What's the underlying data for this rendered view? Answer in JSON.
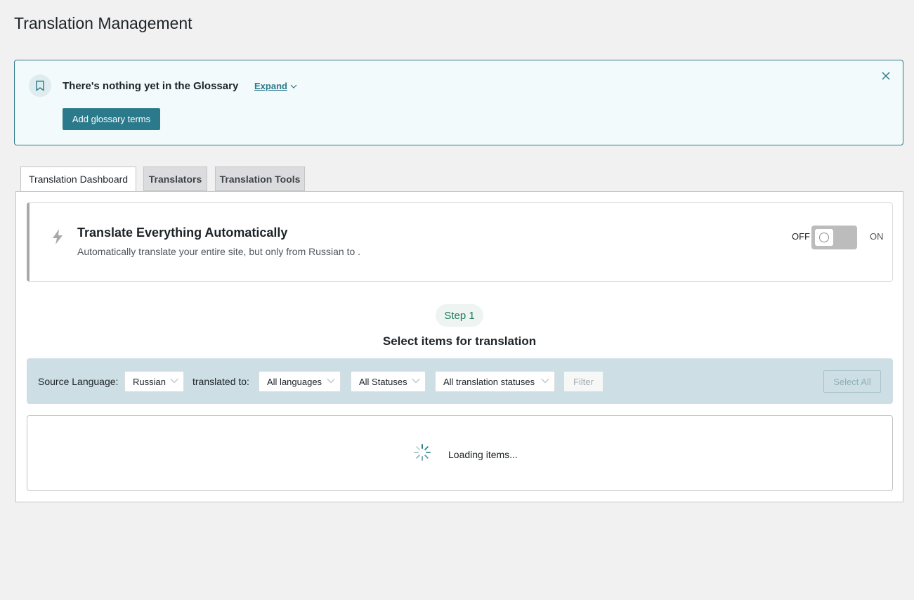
{
  "page": {
    "title": "Translation Management"
  },
  "glossary_notice": {
    "title": "There's nothing yet in the Glossary",
    "expand_label": "Expand",
    "add_button_label": "Add glossary terms"
  },
  "tabs": [
    {
      "label": "Translation Dashboard",
      "active": true
    },
    {
      "label": "Translators",
      "active": false
    },
    {
      "label": "Translation Tools",
      "active": false
    }
  ],
  "auto_translate": {
    "title": "Translate Everything Automatically",
    "description": "Automatically translate your entire site, but only from Russian to .",
    "off_label": "OFF",
    "on_label": "ON",
    "state": "off"
  },
  "step": {
    "label": "Step 1",
    "heading": "Select items for translation"
  },
  "filters": {
    "source_language_label": "Source Language:",
    "source_language_value": "Russian",
    "translated_to_label": "translated to:",
    "target_language_value": "All languages",
    "status_value": "All Statuses",
    "translation_status_value": "All translation statuses",
    "filter_button_label": "Filter",
    "select_all_label": "Select All"
  },
  "items": {
    "loading_text": "Loading items..."
  },
  "colors": {
    "accent": "#2b7a8b",
    "step_text": "#1f7a5c",
    "filter_bar_bg": "#cddfe4"
  }
}
